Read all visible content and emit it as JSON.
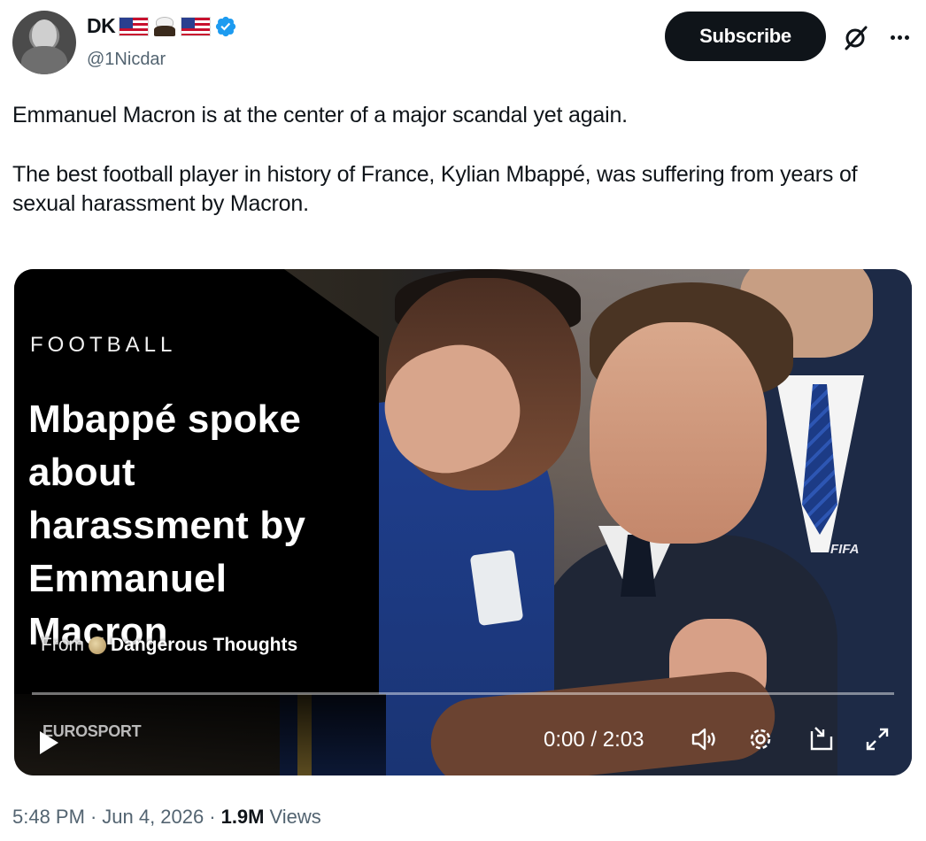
{
  "author": {
    "display_name": "DK",
    "handle": "@1Nicdar",
    "badges": [
      "us-flag-icon",
      "eagle-icon",
      "us-flag-icon",
      "verified-icon"
    ]
  },
  "actions": {
    "subscribe_label": "Subscribe",
    "grok_icon": "grok-icon",
    "more_icon": "more-icon"
  },
  "tweet": {
    "paragraph_1": "Emmanuel Macron is at the center of a major scandal yet again.",
    "paragraph_2": "The best football player in history of France, Kylian Mbappé, was suffering from years of sexual harassment by Macron."
  },
  "video": {
    "category": "FOOTBALL",
    "headline": "Mbappé spoke about harassment by Emmanuel Macron",
    "from_label": "From",
    "source_name": "Dangerous Thoughts",
    "watermark": "EUROSPORT",
    "sticker": "FIFA",
    "time_display": "0:00 / 2:03",
    "progress": 0,
    "controls": [
      "play-icon",
      "volume-icon",
      "settings-icon",
      "pip-icon",
      "fullscreen-icon"
    ]
  },
  "meta": {
    "time": "5:48 PM",
    "separator": "·",
    "date": "Jun 4, 2026",
    "views_count": "1.9M",
    "views_label": "Views"
  },
  "colors": {
    "text": "#0f1419",
    "secondary": "#536471",
    "verified": "#1d9bf0",
    "button_bg": "#0f1419"
  }
}
